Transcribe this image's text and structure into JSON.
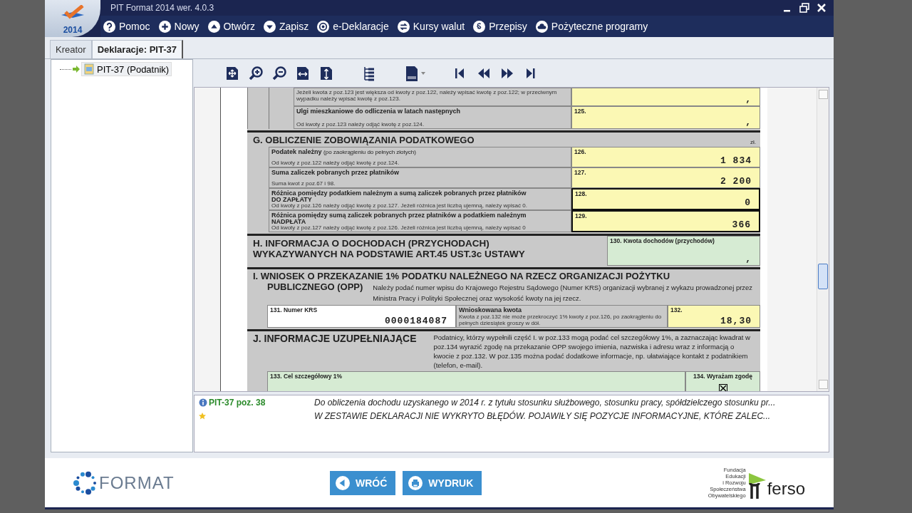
{
  "window": {
    "title": "PIT Format 2014 wer. 4.0.3",
    "logo_year": "2014"
  },
  "menu": [
    "Pomoc",
    "Nowy",
    "Otwórz",
    "Zapisz",
    "e-Deklaracje",
    "Kursy walut",
    "Przepisy",
    "Pożyteczne programy"
  ],
  "tabs": [
    {
      "label": "Kreator",
      "selected": false
    },
    {
      "label": "Deklaracje: PIT-37",
      "selected": true
    }
  ],
  "tree": [
    {
      "label": "PIT-37 (Podatnik)",
      "selected": true
    }
  ],
  "form": {
    "top_rows": [
      {
        "note": "Jeżeli kwota z poz.123 jest większa od kwoty z poz.122, należy wpisać kwotę z poz.122; w przeciwnym wypadku należy wpisać kwotę z poz.123.",
        "value": ","
      },
      {
        "label": "Ulgi mieszkaniowe do odliczenia w latach następnych",
        "note": "Od kwoty z poz.123 należy odjąć kwotę z poz.124.",
        "number": "125.",
        "value": ","
      }
    ],
    "section_g": {
      "title": "G. OBLICZENIE ZOBOWIĄZANIA PODATKOWEGO",
      "unit": "zł.",
      "rows": [
        {
          "label": "Podatek należny",
          "label_hint": "(po zaokrągleniu do pełnych złotych)",
          "note": "Od kwoty z poz.122 należy odjąć kwotę z poz.124.",
          "number": "126.",
          "value": "1 834",
          "emphasized": false
        },
        {
          "label": "Suma zaliczek pobranych przez płatników",
          "note": "Suma kwot z poz.67 i 98.",
          "number": "127.",
          "value": "2 200",
          "emphasized": false
        },
        {
          "label": "Różnica pomiędzy podatkiem należnym a sumą zaliczek pobranych przez płatników",
          "result": "DO ZAPŁATY",
          "note": "Od kwoty z poz.126 należy odjąć kwotę z poz.127. Jeżeli różnica jest liczbą ujemną, należy wpisać 0.",
          "number": "128.",
          "value": "0",
          "emphasized": true
        },
        {
          "label": "Różnica pomiędzy sumą zaliczek pobranych przez płatników a podatkiem należnym",
          "result": "NADPŁATA",
          "note": "Od kwoty z poz.127 należy odjąć kwotę z poz.126. Jeżeli różnica jest liczbą ujemną, należy wpisać 0",
          "number": "129.",
          "value": "366",
          "emphasized": true
        }
      ]
    },
    "section_h": {
      "title_lines": [
        "H. INFORMACJA O DOCHODACH (PRZYCHODACH)",
        "WYKAZYWANYCH NA PODSTAWIE ART.45 UST.3c USTAWY"
      ],
      "field": {
        "kind": "info",
        "number": "130. Kwota dochodów (przychodów)",
        "value": ","
      }
    },
    "section_i": {
      "title": "I. WNIOSEK O PRZEKAZANIE 1% PODATKU NALEŻNEGO NA RZECZ ORGANIZACJI POŻYTKU",
      "subtitle": "PUBLICZNEGO (OPP)",
      "description": "Należy podać numer wpisu do Krajowego Rejestru Sądowego (Numer KRS) organizacji wybranej z wykazu prowadzonej przez Ministra Pracy i Polityki Społecznej oraz wysokość kwoty na jej rzecz.",
      "krs": {
        "kind": "text",
        "number": "131. Numer KRS",
        "value": "0000184087"
      },
      "amount_label": "Wnioskowana kwota",
      "amount_note": "Kwota z poz.132 nie może przekroczyć 1% kwoty z poz.126, po zaokrągleniu do pełnych dziesiątek groszy w dół.",
      "amount": {
        "kind": "amount",
        "number": "132.",
        "value": "18,30"
      }
    },
    "section_j": {
      "title": "J. INFORMACJE UZUPEŁNIAJĄCE",
      "description": "Podatnicy, którzy wypełnili część I. w poz.133 mogą podać cel szczegółowy 1%, a zaznaczając kwadrat w poz.134 wyrazić zgodę na przekazanie OPP swojego imienia, nazwiska i adresu wraz z informacją o kwocie z poz.132. W poz.135 można podać dodatkowe informacje, np. ułatwiające kontakt z podatnikiem (telefon, e-mail).",
      "goal": {
        "kind": "info",
        "number": "133. Cel szczegółowy 1%"
      },
      "consent": {
        "label": "134. Wyrażam zgodę",
        "checked": true
      }
    }
  },
  "messages": [
    {
      "kind": "info",
      "source": "PIT-37 poz. 38",
      "text": "Do obliczenia dochodu uzyskanego w 2014 r. z tytułu stosunku służbowego, stosunku pracy, spółdzielczego stosunku pr..."
    },
    {
      "kind": "notice",
      "text": "W ZESTAWIE DEKLARACJI NIE WYKRYTO BŁĘDÓW. POJAWIŁY SIĘ POZYCJE INFORMACYJNE, KTÓRE ZALEC..."
    }
  ],
  "footer": {
    "left_logo": "FORMAT",
    "buttons": [
      "WRÓĆ",
      "WYDRUK"
    ],
    "right_logo_caption": [
      "Fundacja",
      "Edukacji",
      "i Rozwoju",
      "Społeczeństwa",
      "Obywatelskiego"
    ],
    "right_logo": "ferso"
  }
}
